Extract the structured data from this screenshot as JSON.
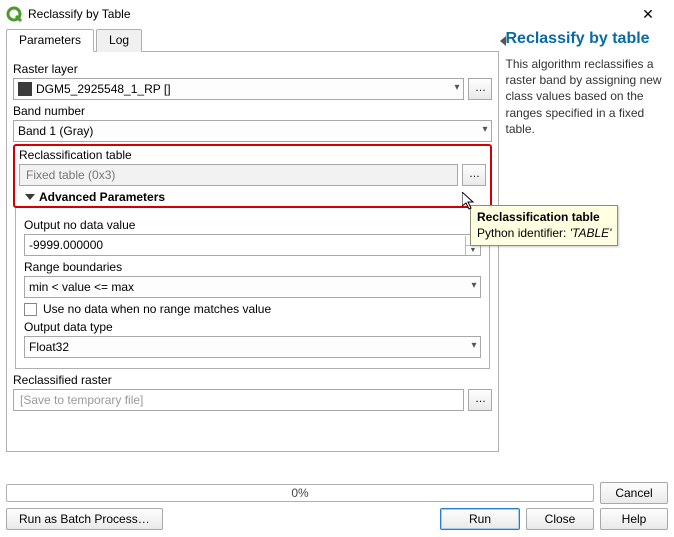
{
  "window": {
    "title": "Reclassify by Table"
  },
  "tabs": {
    "parameters": "Parameters",
    "log": "Log"
  },
  "params": {
    "raster_layer_label": "Raster layer",
    "raster_layer_value": "DGM5_2925548_1_RP []",
    "band_number_label": "Band number",
    "band_number_value": "Band 1 (Gray)",
    "reclass_table_label": "Reclassification table",
    "reclass_table_value": "Fixed table (0x3)",
    "advanced_label": "Advanced Parameters",
    "no_data_label": "Output no data value",
    "no_data_value": "-9999.000000",
    "range_boundaries_label": "Range boundaries",
    "range_boundaries_value": "min < value <= max",
    "use_nodata_label": "Use no data when no range matches value",
    "output_datatype_label": "Output data type",
    "output_datatype_value": "Float32",
    "reclassified_raster_label": "Reclassified raster",
    "reclassified_raster_placeholder": "[Save to temporary file]"
  },
  "help": {
    "title": "Reclassify by table",
    "body": "This algorithm reclassifies a raster band by assigning new class values based on the ranges specified in a fixed table."
  },
  "tooltip": {
    "title": "Reclassification table",
    "line_prefix": "Python identifier: ",
    "identifier": "'TABLE'"
  },
  "progress": {
    "text": "0%"
  },
  "buttons": {
    "batch": "Run as Batch Process…",
    "run": "Run",
    "close": "Close",
    "help": "Help",
    "cancel": "Cancel",
    "ellipsis": "…"
  }
}
